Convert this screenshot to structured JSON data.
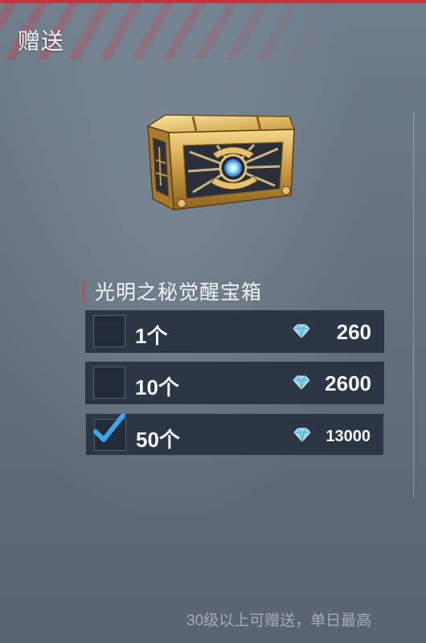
{
  "header": {
    "title": "赠送"
  },
  "item": {
    "name": "光明之秘觉醒宝箱"
  },
  "options": [
    {
      "qty": "1个",
      "price": "260",
      "checked": false
    },
    {
      "qty": "10个",
      "price": "2600",
      "checked": false
    },
    {
      "qty": "50个",
      "price": "13000",
      "checked": true
    }
  ],
  "footer": {
    "note": "30级以上可赠送，单日最高"
  },
  "colors": {
    "accent_red": "#c8323e",
    "option_bg": "#2c3644",
    "check_blue": "#3aa8e8",
    "gem_blue": "#8fd6f2"
  },
  "icons": {
    "currency": "diamond-icon",
    "check": "checkmark-icon",
    "item": "treasure-chest-icon"
  }
}
